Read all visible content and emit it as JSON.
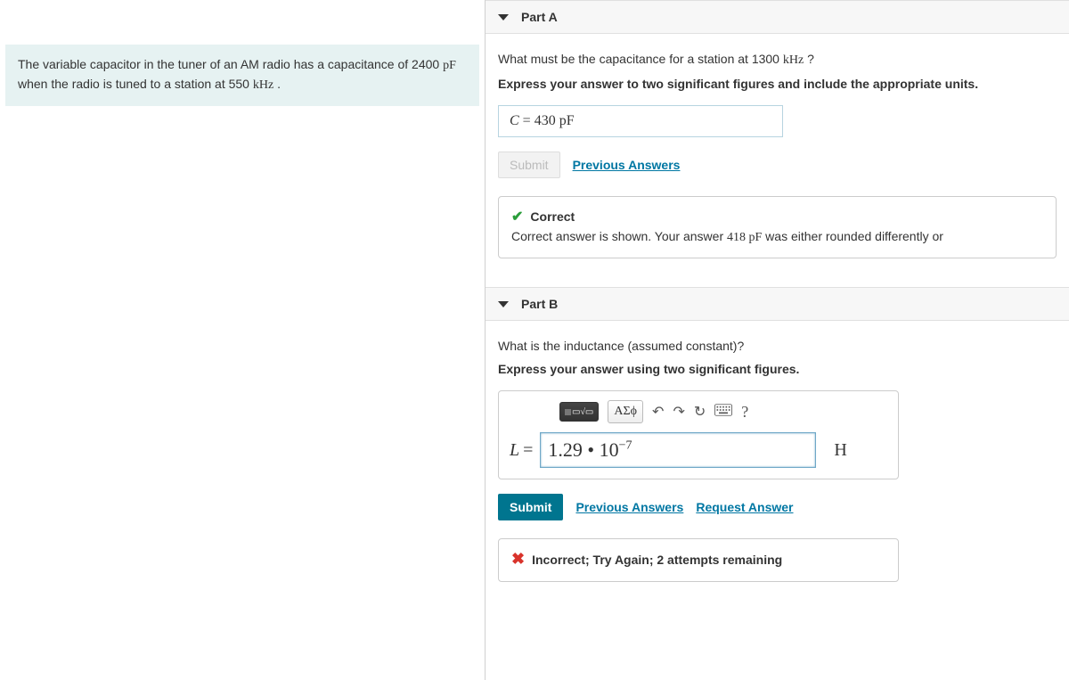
{
  "problem": {
    "text_1": "The variable capacitor in the tuner of an AM radio has a capacitance of 2400 ",
    "unit_1": "pF",
    "text_2": " when the radio is tuned to a station at 550 ",
    "unit_2": "kHz",
    "text_3": " ."
  },
  "partA": {
    "title": "Part A",
    "question_1": "What must be the capacitance for a station at 1300 ",
    "question_unit": "kHz",
    "question_2": " ?",
    "instructions": "Express your answer to two significant figures and include the appropriate units.",
    "answer_var": "C",
    "answer_eq": " = ",
    "answer_val": "430 pF",
    "submit_label": "Submit",
    "prev_label": "Previous Answers",
    "fb_title": "Correct",
    "fb_text_1": "Correct answer is shown. Your answer ",
    "fb_value": "418 pF",
    "fb_text_2": " was either rounded differently or"
  },
  "partB": {
    "title": "Part B",
    "question": "What is the inductance (assumed constant)?",
    "instructions": "Express your answer using two significant figures.",
    "toolbar": {
      "templates": "▭√▭",
      "greek": "ΑΣϕ",
      "help": "?"
    },
    "var_label": "L",
    "eq": " = ",
    "value_base": "1.29 • 10",
    "value_exp": "−7",
    "unit": "H",
    "submit_label": "Submit",
    "prev_label": "Previous Answers",
    "request_label": "Request Answer",
    "fb_text": "Incorrect; Try Again; 2 attempts remaining"
  }
}
